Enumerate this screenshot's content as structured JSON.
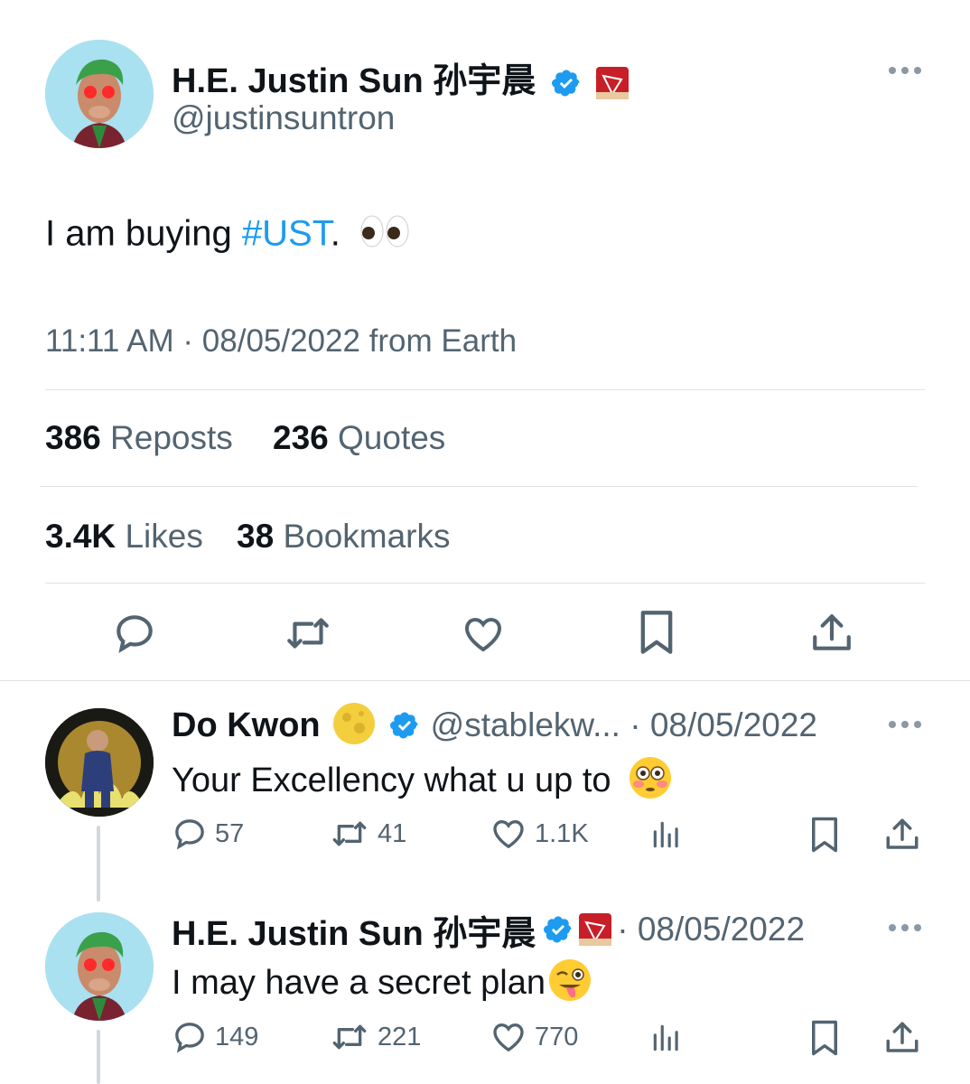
{
  "main_tweet": {
    "author_name": "H.E. Justin Sun 孙宇晨",
    "handle": "@justinsuntron",
    "text_prefix": "I am buying ",
    "hashtag": "#UST",
    "text_suffix": ".",
    "timestamp": "11:11 AM · 08/05/2022 from Earth",
    "reposts_count": "386",
    "reposts_label": "Reposts",
    "quotes_count": "236",
    "quotes_label": "Quotes",
    "likes_count": "3.4K",
    "likes_label": "Likes",
    "bookmarks_count": "38",
    "bookmarks_label": "Bookmarks"
  },
  "replies": [
    {
      "author_name": "Do Kwon",
      "handle_date": "@stablekw... · 08/05/2022",
      "text": "Your Excellency what u up to",
      "replies": "57",
      "reposts": "41",
      "likes": "1.1K"
    },
    {
      "author_name": "H.E. Justin Sun 孙宇晨",
      "handle_date": "· 08/05/2022",
      "text": "I may have a secret plan",
      "replies": "149",
      "reposts": "221",
      "likes": "770"
    }
  ],
  "colors": {
    "accent": "#1d9bf0",
    "text_primary": "#0f1419",
    "text_secondary": "#536471",
    "divider": "#dde3e8"
  },
  "icons": [
    "reply-icon",
    "repost-icon",
    "like-icon",
    "bookmark-icon",
    "share-icon",
    "views-icon",
    "verified-icon",
    "more-icon"
  ]
}
